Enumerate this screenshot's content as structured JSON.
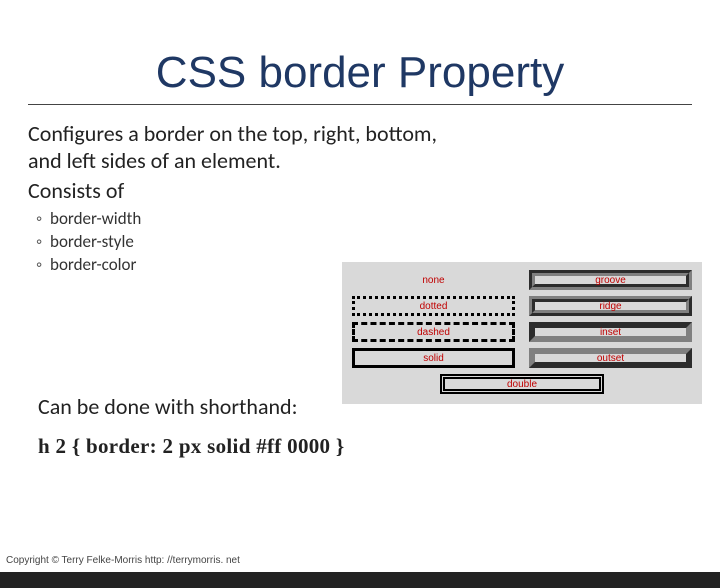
{
  "title": "CSS border Property",
  "intro": "Configures a border on the top, right, bottom, and left sides of an element.",
  "consists_label": "Consists of",
  "sublist": {
    "item0": "border-width",
    "item1": "border-style",
    "item2": "border-color"
  },
  "shorthand_label": "Can be done with shorthand:",
  "code_example": "h 2 { border: 2 px solid #ff 0000 }",
  "copyright": "Copyright © Terry Felke-Morris http: //terrymorris. net",
  "demo": {
    "none": "none",
    "groove": "groove",
    "dotted": "dotted",
    "ridge": "ridge",
    "dashed": "dashed",
    "inset": "inset",
    "solid": "solid",
    "outset": "outset",
    "double": "double"
  }
}
